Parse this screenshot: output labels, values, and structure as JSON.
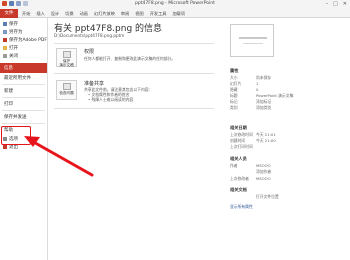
{
  "window": {
    "title": "ppt47F8.png - Microsoft PowerPoint",
    "minimize_glyph": "–",
    "maximize_glyph": "□",
    "close_glyph": "✕"
  },
  "ribbon": {
    "file_tab": "文件",
    "tabs": [
      "开始",
      "插入",
      "设计",
      "切换",
      "动画",
      "幻灯片放映",
      "审阅",
      "视图",
      "开发工具",
      "加载项"
    ]
  },
  "sidebar": {
    "items": [
      {
        "label": "保存"
      },
      {
        "label": "另存为"
      },
      {
        "label": "保存为Adobe PDF"
      },
      {
        "label": "打开"
      },
      {
        "label": "关闭"
      },
      {
        "label": "信息"
      },
      {
        "label": "最近所用文件"
      },
      {
        "label": "新建"
      },
      {
        "label": "打印"
      },
      {
        "label": "保存并发送"
      },
      {
        "label": "帮助"
      },
      {
        "label": "选项"
      },
      {
        "label": "退出"
      }
    ]
  },
  "main": {
    "doc_title": "有关 ppt47F8.png 的信息",
    "doc_path": "D:\\Documents\\ppt47F8.png.pptm",
    "permissions": {
      "button_label_1": "保护",
      "button_label_2": "演示文稿",
      "title": "权限",
      "desc": "任何人都能打开、复制和更改此演示文稿的任何部分。"
    },
    "prepare": {
      "button_label_1": "检查问题",
      "title": "准备共享",
      "desc": "共享此文件前，请注意其包含以下内容：",
      "bullets": [
        "文档属性和作者的姓名",
        "残障人士难以阅读的内容"
      ]
    }
  },
  "properties": {
    "heading": "属性",
    "rows": [
      {
        "k": "大小",
        "v": "尚未保存"
      },
      {
        "k": "幻灯片",
        "v": "1"
      },
      {
        "k": "隐藏",
        "v": "0"
      },
      {
        "k": "标题",
        "v": "PowerPoint 演示文稿"
      },
      {
        "k": "标记",
        "v": "添加标记"
      },
      {
        "k": "类别",
        "v": "添加类别"
      }
    ],
    "dates_heading": "相关日期",
    "dates": [
      {
        "k": "上次修改时间",
        "v": "今天 21:01"
      },
      {
        "k": "创建时间",
        "v": "今天 21:00"
      },
      {
        "k": "上次打印时间",
        "v": ""
      }
    ],
    "people_heading": "相关人员",
    "people": [
      {
        "k": "作者",
        "v": "MSOOO"
      },
      {
        "k": "",
        "v": "添加作者"
      },
      {
        "k": "上次修改者",
        "v": "MSOOO"
      }
    ],
    "docs_heading": "相关文档",
    "docs": [
      {
        "k": "",
        "v": "打开文件位置"
      }
    ],
    "show_all": "显示所有属性"
  },
  "colors": {
    "accent": "#c8392b",
    "highlight": "#e8141b"
  }
}
